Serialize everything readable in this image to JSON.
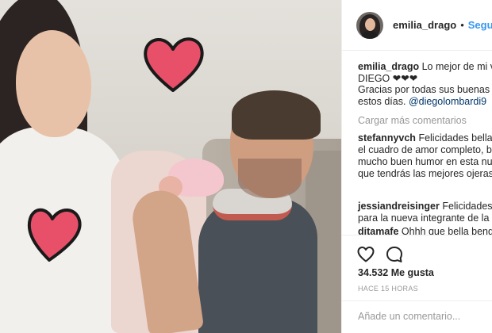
{
  "header": {
    "username": "emilia_drago",
    "separator": "•",
    "follow_label": "Seguir"
  },
  "caption": {
    "username": "emilia_drago",
    "text_1": "Lo mejor de mi vida",
    "text_2": "DIEGO ❤❤❤",
    "text_3": "Gracias por todas sus buenas energías",
    "text_4": "estos días.",
    "mention": "@diegolombardi9"
  },
  "load_more_label": "Cargar más comentarios",
  "comments": [
    {
      "username": "stefannyvch",
      "text": "Felicidades bella Emilia, tienes el cuadro de amor completo, bendiciones y mucho buen humor en esta nueva etapa en la que tendrás las mejores ojeras de tu vida! 😉"
    },
    {
      "username": "jessiandreisinger",
      "text": "Felicidades y bendiciones para la nueva integrante de la familia"
    },
    {
      "username": "ditamafe",
      "text": "Ohhh que bella bendición"
    }
  ],
  "actions": {
    "likes": "34.532 Me gusta",
    "timestamp": "HACE 15 HORAS",
    "comment_placeholder": "Añade un comentario..."
  },
  "colors": {
    "follow": "#3897f0",
    "heart": "#e8506a",
    "muted": "#999999"
  },
  "icons": [
    "heart-icon",
    "comment-icon"
  ]
}
